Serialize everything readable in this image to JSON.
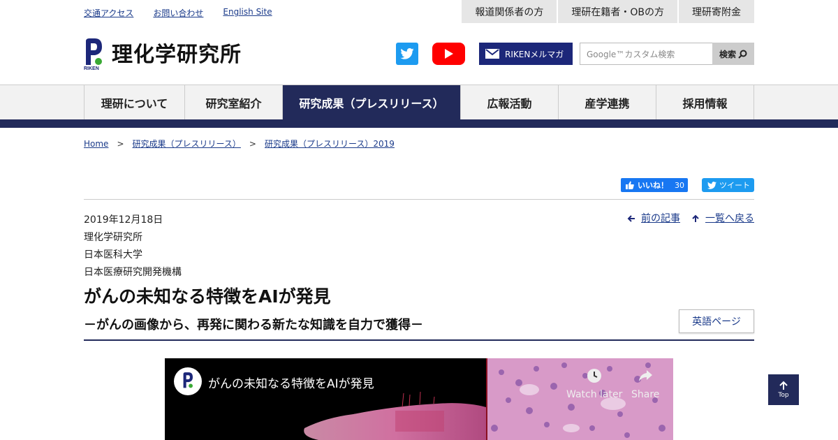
{
  "util_links": [
    "交通アクセス",
    "お問い合わせ",
    "English Site"
  ],
  "util_tabs": [
    "報道関係者の方",
    "理研在籍者・OBの方",
    "理研寄附金"
  ],
  "header": {
    "logo_text": "理化学研究所",
    "logo_sub": "RIKEN",
    "mail_label": "RIKENメルマガ",
    "search_placeholder": "Google™カスタム検索",
    "search_button": "検索"
  },
  "nav": [
    "理研について",
    "研究室紹介",
    "研究成果（プレスリリース）",
    "広報活動",
    "産学連携",
    "採用情報"
  ],
  "breadcrumb": [
    "Home",
    "研究成果（プレスリリース）",
    "研究成果（プレスリリース）2019"
  ],
  "breadcrumb_sep": ">",
  "share": {
    "like_label": "いいね！",
    "like_count": "30",
    "tweet_label": "ツイート"
  },
  "article": {
    "date": "2019年12月18日",
    "orgs": [
      "理化学研究所",
      "日本医科大学",
      "日本医療研究開発機構"
    ],
    "title": "がんの未知なる特徴をAIが発見",
    "subtitle": "－がんの画像から、再発に関わる新たな知識を自力で獲得－",
    "english_button": "英語ページ"
  },
  "pager": {
    "prev": "前の記事",
    "list": "一覧へ戻る"
  },
  "video": {
    "title": "がんの未知なる特徴をAIが発見",
    "watch_later": "Watch later",
    "share": "Share"
  },
  "top_button": "Top",
  "colors": {
    "navy": "#222a5a",
    "link": "#1a3a8a",
    "riken_green": "#3aa935",
    "twitter": "#1d9bf0",
    "youtube": "#ff0000",
    "facebook": "#1877f2"
  }
}
